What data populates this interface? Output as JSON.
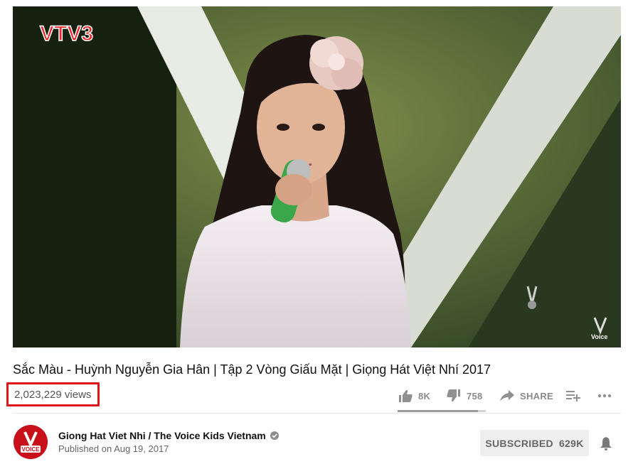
{
  "video": {
    "title": "Sắc Màu - Huỳnh Nguyễn Gia Hân | Tập 2 Vòng Giấu Mặt | Giọng Hát Việt Nhí 2017",
    "views": "2,023,229 views",
    "thumbnail_logo": "VTV3",
    "thumbnail_watermark_logo": "The Voice Kids",
    "highlight_color": "#e0151b"
  },
  "actions": {
    "like_count": "8K",
    "dislike_count": "758",
    "share_label": "SHARE",
    "like_ratio": 0.91
  },
  "channel": {
    "name": "Giong Hat Viet Nhi / The Voice Kids Vietnam",
    "published": "Published on Aug 19, 2017",
    "subscribe_label": "SUBSCRIBED",
    "subscriber_count": "629K",
    "avatar_logo": "The Voice Kids",
    "avatar_color": "#c8101a"
  },
  "icons": [
    "like-icon",
    "dislike-icon",
    "share-icon",
    "add-to-playlist-icon",
    "more-icon",
    "verified-icon",
    "bell-icon"
  ]
}
